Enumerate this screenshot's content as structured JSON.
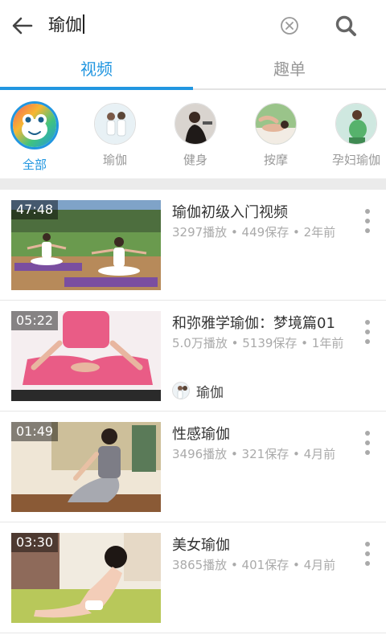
{
  "search": {
    "query": "瑜伽"
  },
  "tabs": [
    {
      "label": "视频",
      "active": true
    },
    {
      "label": "趣单",
      "active": false
    }
  ],
  "categories": [
    {
      "label": "全部",
      "active": true,
      "icon": "frog-icon"
    },
    {
      "label": "瑜伽",
      "active": false
    },
    {
      "label": "健身",
      "active": false
    },
    {
      "label": "按摩",
      "active": false
    },
    {
      "label": "孕妇瑜伽",
      "active": false
    }
  ],
  "videos": [
    {
      "duration": "47:48",
      "title": "瑜伽初级入门视频",
      "meta": "3297播放 • 449保存 • 2年前"
    },
    {
      "duration": "05:22",
      "title": "和弥雅学瑜伽：梦境篇01",
      "meta": "5.0万播放 • 5139保存 • 1年前",
      "owner": "瑜伽"
    },
    {
      "duration": "01:49",
      "title": "性感瑜伽",
      "meta": "3496播放 • 321保存 • 4月前"
    },
    {
      "duration": "03:30",
      "title": "美女瑜伽",
      "meta": "3865播放 • 401保存 • 4月前"
    }
  ],
  "colors": {
    "accent": "#2196e0",
    "muted": "#aaaaaa",
    "divider": "#ebebeb"
  }
}
